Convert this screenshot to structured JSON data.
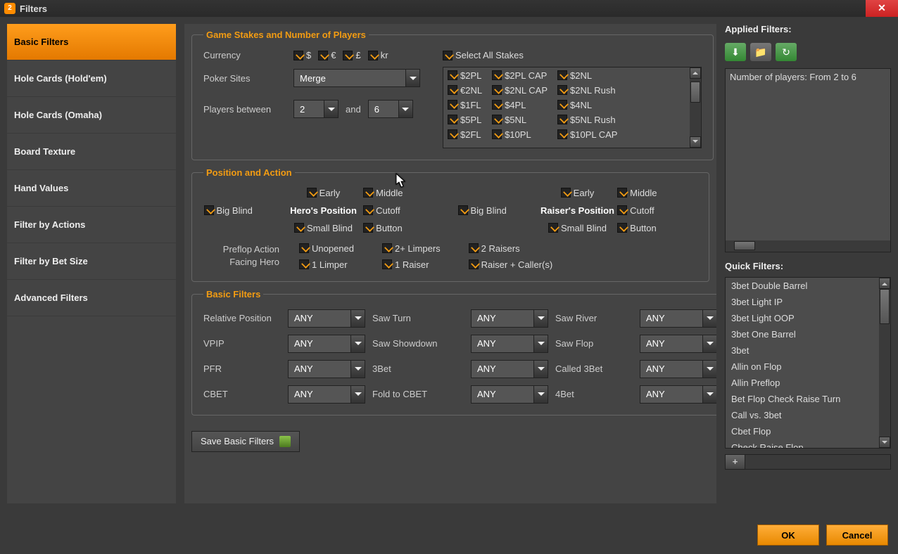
{
  "window": {
    "title": "Filters"
  },
  "sidebar": {
    "items": [
      {
        "label": "Basic Filters",
        "active": true
      },
      {
        "label": "Hole Cards (Hold'em)"
      },
      {
        "label": "Hole Cards (Omaha)"
      },
      {
        "label": "Board Texture"
      },
      {
        "label": "Hand Values"
      },
      {
        "label": "Filter by Actions"
      },
      {
        "label": "Filter by Bet Size"
      },
      {
        "label": "Advanced Filters"
      }
    ]
  },
  "group1": {
    "legend": "Game Stakes and Number of Players",
    "currency_label": "Currency",
    "currencies": [
      "$",
      "€",
      "£",
      "kr"
    ],
    "poker_sites_label": "Poker Sites",
    "poker_sites_value": "Merge",
    "players_label": "Players between",
    "players_from": "2",
    "players_and": "and",
    "players_to": "6",
    "select_all_label": "Select All Stakes",
    "stakes": {
      "col1": [
        "$2PL",
        "€2NL",
        "$1FL",
        "$5PL",
        "$2FL"
      ],
      "col2": [
        "$2PL CAP",
        "$2NL CAP",
        "$4PL",
        "$5NL",
        "$10PL"
      ],
      "col3": [
        "$2NL",
        "$2NL Rush",
        "$4NL",
        "$5NL Rush",
        "$10PL CAP"
      ]
    }
  },
  "group2": {
    "legend": "Position and Action",
    "hero_heading": "Hero's Position",
    "raiser_heading": "Raiser's Position",
    "positions": {
      "early": "Early",
      "middle": "Middle",
      "bb": "Big Blind",
      "cutoff": "Cutoff",
      "sb": "Small Blind",
      "button": "Button"
    },
    "preflop_label1": "Preflop Action",
    "preflop_label2": "Facing Hero",
    "preflop": {
      "unopened": "Unopened",
      "one_limper": "1 Limper",
      "two_limpers": "2+ Limpers",
      "one_raiser": "1 Raiser",
      "two_raisers": "2 Raisers",
      "raiser_callers": "Raiser + Caller(s)"
    }
  },
  "group3": {
    "legend": "Basic Filters",
    "any": "ANY",
    "labels": {
      "rel_pos": "Relative Position",
      "saw_turn": "Saw Turn",
      "saw_river": "Saw River",
      "vpip": "VPIP",
      "saw_showdown": "Saw Showdown",
      "saw_flop": "Saw Flop",
      "pfr": "PFR",
      "threebet": "3Bet",
      "called_3bet": "Called 3Bet",
      "cbet": "CBET",
      "fold_cbet": "Fold to CBET",
      "fourbet": "4Bet"
    }
  },
  "save_btn": "Save Basic Filters",
  "right": {
    "applied_header": "Applied Filters:",
    "applied_text": "Number of players: From 2 to 6",
    "quick_header": "Quick Filters:",
    "quick_items": [
      "3bet Double Barrel",
      "3bet Light IP",
      "3bet Light OOP",
      "3bet One Barrel",
      "3bet",
      "Allin on Flop",
      "Allin Preflop",
      "Bet Flop Check Raise Turn",
      "Call vs. 3bet",
      "Cbet Flop",
      "Check Raise Flop"
    ]
  },
  "footer": {
    "ok": "OK",
    "cancel": "Cancel"
  }
}
